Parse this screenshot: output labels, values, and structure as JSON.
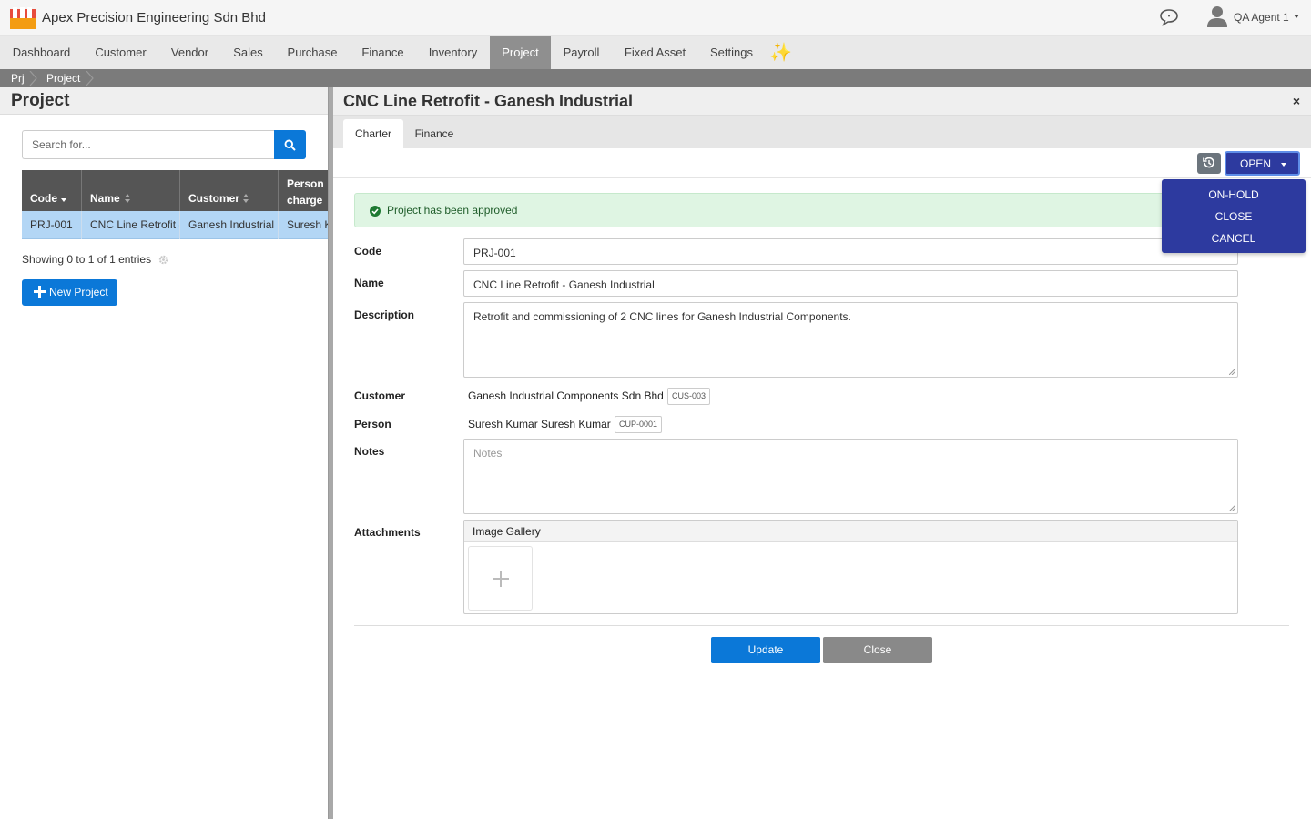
{
  "app": {
    "title": "Apex Precision Engineering Sdn Bhd",
    "logo_icon": "store-logo-icon",
    "chat_icon": "chat-icon",
    "user_icon": "user-icon",
    "user_name": "QA Agent 1"
  },
  "nav": {
    "items": [
      "Dashboard",
      "Customer",
      "Vendor",
      "Sales",
      "Purchase",
      "Finance",
      "Inventory",
      "Project",
      "Payroll",
      "Fixed Asset",
      "Settings"
    ],
    "active": "Project",
    "sparkle_icon": "sparkle-icon",
    "sparkle": "✨"
  },
  "breadcrumb": [
    "Prj",
    "Project"
  ],
  "left": {
    "title": "Project",
    "search_placeholder": "Search for...",
    "columns": [
      "Code",
      "Name",
      "Customer",
      "Person",
      "charge"
    ],
    "rows": [
      {
        "code": "PRJ-001",
        "name": "CNC Line Retrofit - Ganesh Industrial",
        "customer": "Ganesh Industrial Components Sdn Bhd",
        "person": "Suresh Kumar"
      }
    ],
    "showing": "Showing 0 to 1 of 1 entries",
    "new_button": "New Project"
  },
  "right": {
    "title": "CNC Line Retrofit - Ganesh Industrial",
    "tabs": [
      "Charter",
      "Finance"
    ],
    "active_tab": "Charter",
    "status": "OPEN",
    "status_menu": [
      "ON-HOLD",
      "CLOSE",
      "CANCEL"
    ],
    "alert": "Project has been approved",
    "labels": {
      "code": "Code",
      "name": "Name",
      "description": "Description",
      "customer": "Customer",
      "person": "Person",
      "notes": "Notes",
      "attachments": "Attachments"
    },
    "values": {
      "code": "PRJ-001",
      "name": "CNC Line Retrofit - Ganesh Industrial",
      "description": "Retrofit and commissioning of 2 CNC lines for Ganesh Industrial Components.",
      "customer": "Ganesh Industrial Components Sdn Bhd",
      "customer_code": "CUS-003",
      "person": "Suresh Kumar Suresh Kumar",
      "person_code": "CUP-0001",
      "notes_placeholder": "Notes"
    },
    "gallery_title": "Image Gallery",
    "update_button": "Update",
    "close_button": "Close"
  },
  "colors": {
    "primary": "#0b78d8",
    "status": "#2d3a9f",
    "alert_bg": "#dff5e3",
    "alert_text": "#1f5d2a",
    "nav_active": "#8f8f8f"
  }
}
